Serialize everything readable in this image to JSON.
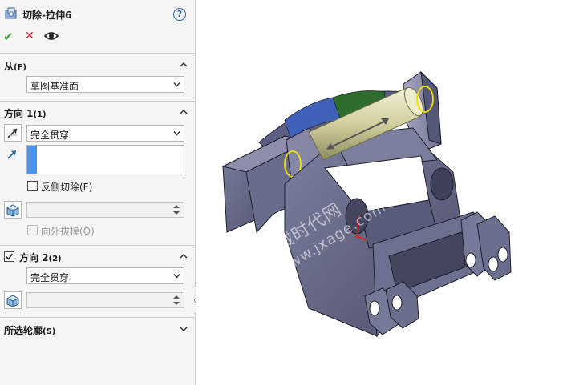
{
  "feature": {
    "title": "切除-拉伸6",
    "help_glyph": "?",
    "ok_glyph": "✔",
    "cancel_glyph": "✕"
  },
  "from_section": {
    "title": "从",
    "suffix": "(F)",
    "selected": "草图基准面"
  },
  "direction1": {
    "title": "方向 1",
    "suffix": "(1)",
    "end_condition": "完全贯穿",
    "flip_side_label": "反侧切除(F)",
    "flip_side_checked": false,
    "draft_outward_label": "向外拔模(O)",
    "draft_outward_enabled": false
  },
  "direction2": {
    "title": "方向 2",
    "suffix": "(2)",
    "checked": true,
    "end_condition": "完全贯穿"
  },
  "selected_contours": {
    "title": "所选轮廓",
    "suffix": "(S)"
  },
  "watermark": {
    "line1": "机械时代网",
    "line2": "www.jxage.com"
  },
  "colors": {
    "accent": "#4d93e8",
    "ok": "#3ba33b",
    "cancel": "#d42222",
    "part": "#6f7191",
    "part_dark": "#4d4f6a",
    "part_light": "#9a9bb8"
  },
  "icons": {
    "feature": "cut-extrude-icon",
    "help": "help-icon",
    "ok": "checkmark-icon",
    "cancel": "close-icon",
    "preview": "eye-icon"
  }
}
